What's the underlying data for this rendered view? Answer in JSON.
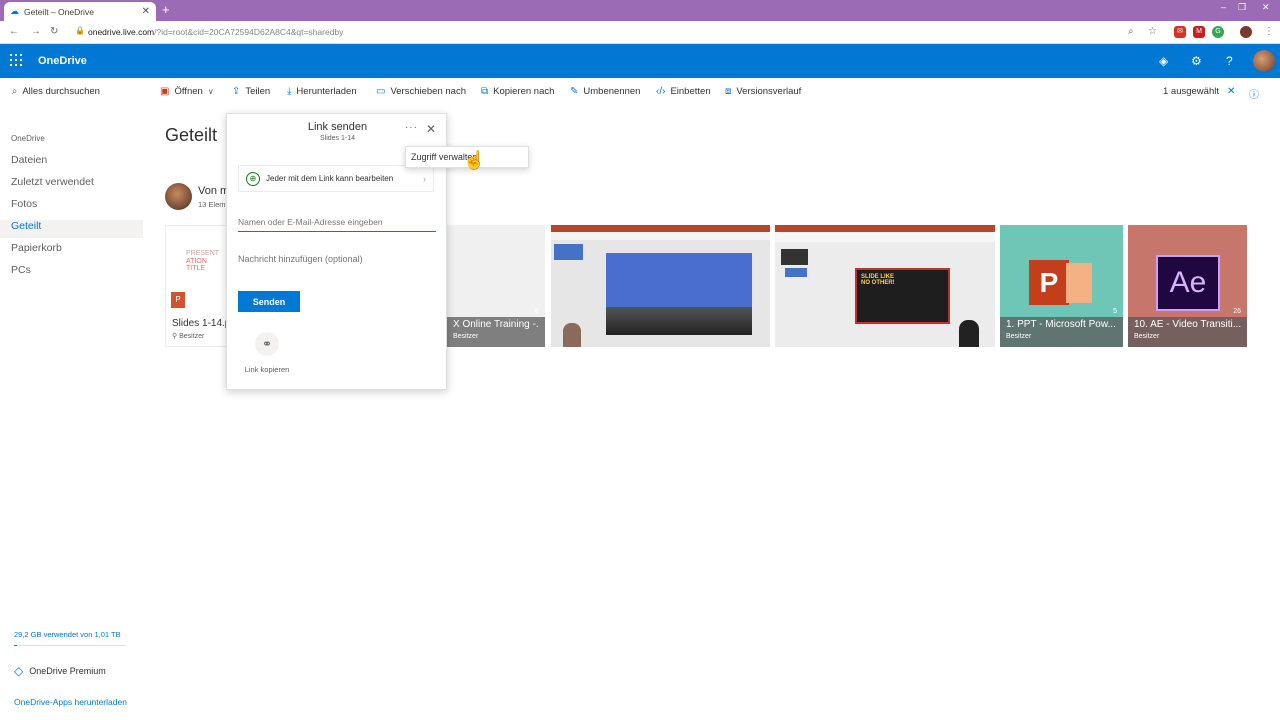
{
  "browser": {
    "tab_title": "Geteilt – OneDrive",
    "url_host": "onedrive.live.com",
    "url_path": "/?id=root&cid=20CA72594D62A8C4&qt=sharedby"
  },
  "suite": {
    "brand": "OneDrive"
  },
  "search": {
    "placeholder": "Alles durchsuchen"
  },
  "commands": {
    "open": "Öffnen",
    "share": "Teilen",
    "download": "Herunterladen",
    "move": "Verschieben nach",
    "copy": "Kopieren nach",
    "rename": "Umbenennen",
    "embed": "Einbetten",
    "history": "Versionsverlauf",
    "selected": "1 ausgewählt"
  },
  "sidebar": {
    "heading": "OneDrive",
    "items": [
      {
        "label": "Dateien"
      },
      {
        "label": "Zuletzt verwendet"
      },
      {
        "label": "Fotos"
      },
      {
        "label": "Geteilt"
      },
      {
        "label": "Papierkorb"
      },
      {
        "label": "PCs"
      }
    ],
    "storage": "29,2 GB verwendet von 1,01 TB",
    "storage_used_fraction": 0.029,
    "premium": "OneDrive Premium",
    "get_apps": "OneDrive-Apps herunterladen"
  },
  "main": {
    "title": "Geteilt",
    "owner_label": "Von m",
    "owner_sub": "13 Elem",
    "tiles": [
      {
        "name": "Slides 1-14.p",
        "sub": "Besitzer",
        "count": ""
      },
      {
        "name": "X Online Training -...",
        "sub": "Besitzer",
        "count": "8"
      },
      {
        "name": "",
        "sub": "",
        "count": ""
      },
      {
        "name": "",
        "sub": "",
        "count": ""
      },
      {
        "name": "1. PPT - Microsoft Pow...",
        "sub": "Besitzer",
        "count": "5"
      },
      {
        "name": "10. AE - Video Transiti...",
        "sub": "Besitzer",
        "count": "26"
      }
    ],
    "thumb_texts": {
      "pres": "PRESENT",
      "ation": "ATION TITLE",
      "slide_like": "SLIDE LIKE",
      "no_other": "NO OTHER!",
      "ae": "Ae"
    }
  },
  "dialog": {
    "title": "Link senden",
    "subtitle": "Slides 1-14",
    "permission": "Jeder mit dem Link kann bearbeiten",
    "to_placeholder": "Namen oder E-Mail-Adresse eingeben",
    "message_placeholder": "Nachricht hinzufügen (optional)",
    "send": "Senden",
    "copy_link": "Link kopieren"
  },
  "context_menu": {
    "item": "Zugriff verwalten"
  },
  "colors": {
    "accent": "#0078d4",
    "browser_frame": "#9b6bb5"
  }
}
